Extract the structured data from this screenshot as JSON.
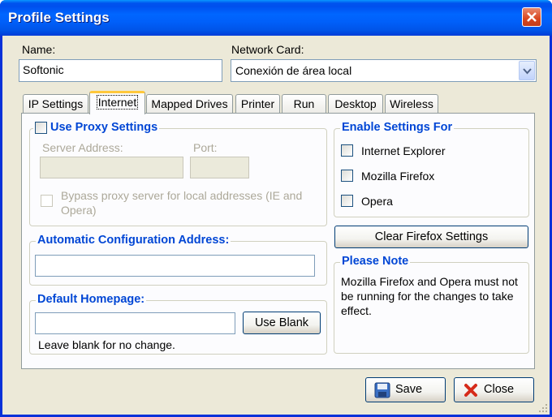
{
  "window": {
    "title": "Profile Settings"
  },
  "fields": {
    "name_label": "Name:",
    "name_value": "Softonic",
    "network_label": "Network Card:",
    "network_value": "Conexión de área local"
  },
  "tabs": [
    {
      "label": "IP Settings"
    },
    {
      "label": "Internet"
    },
    {
      "label": "Mapped Drives"
    },
    {
      "label": "Printer"
    },
    {
      "label": "Run"
    },
    {
      "label": "Desktop"
    },
    {
      "label": "Wireless"
    }
  ],
  "proxy": {
    "title": "Use Proxy Settings",
    "server_label": "Server Address:",
    "port_label": "Port:",
    "server_value": "",
    "port_value": "",
    "bypass_label": "Bypass proxy server for local addresses (IE and Opera)"
  },
  "auto_config": {
    "title": "Automatic Configuration Address:",
    "value": ""
  },
  "homepage": {
    "title": "Default Homepage:",
    "value": "",
    "use_blank": "Use Blank",
    "hint": "Leave blank for no change."
  },
  "enable_settings": {
    "title": "Enable Settings For",
    "items": [
      "Internet Explorer",
      "Mozilla Firefox",
      "Opera"
    ]
  },
  "clear_firefox": "Clear Firefox Settings",
  "note": {
    "title": "Please Note",
    "text": "Mozilla Firefox and Opera must not be running for the changes to take effect."
  },
  "footer": {
    "save": "Save",
    "close": "Close"
  },
  "colors": {
    "title_bar": "#0054e8",
    "group_title": "#0046d5",
    "tab_highlight": "#ffc83c"
  }
}
